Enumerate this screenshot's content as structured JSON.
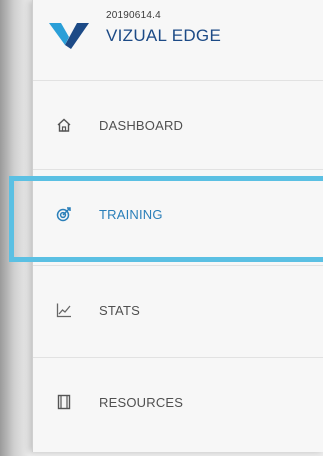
{
  "app": {
    "version": "20190614.4",
    "brand": "VIZUAL EDGE",
    "brand_color": "#1c4a86",
    "accent_color": "#2a7fb9",
    "highlight_color": "#5bc0e3"
  },
  "nav": {
    "items": [
      {
        "label": "DASHBOARD",
        "icon": "home-icon",
        "active": false
      },
      {
        "label": "TRAINING",
        "icon": "target-icon",
        "active": true
      },
      {
        "label": "STATS",
        "icon": "line-chart-icon",
        "active": false
      },
      {
        "label": "RESOURCES",
        "icon": "book-icon",
        "active": false
      }
    ]
  }
}
